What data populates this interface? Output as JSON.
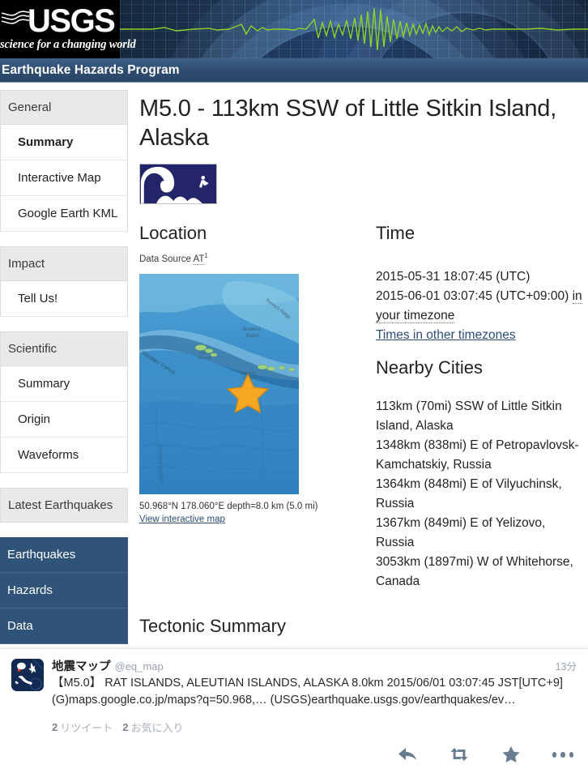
{
  "banner": {
    "logo_word": "USGS",
    "logo_tagline": "science for a changing world",
    "logo_mark_icon": "usgs-wave-mark-icon",
    "seismograph_icon": "seismograph-trace-icon"
  },
  "program_bar": {
    "title": "Earthquake Hazards Program"
  },
  "sidebar": {
    "groups": [
      {
        "header": "General",
        "items": [
          {
            "label": "Summary",
            "active": true
          },
          {
            "label": "Interactive Map",
            "active": false
          },
          {
            "label": "Google Earth KML",
            "active": false
          }
        ]
      },
      {
        "header": "Impact",
        "items": [
          {
            "label": "Tell Us!",
            "active": false
          }
        ]
      },
      {
        "header": "Scientific",
        "items": [
          {
            "label": "Summary",
            "active": false
          },
          {
            "label": "Origin",
            "active": false
          },
          {
            "label": "Waveforms",
            "active": false
          }
        ]
      },
      {
        "header": "Latest Earthquakes",
        "items": []
      }
    ],
    "blue_items": [
      {
        "label": "Earthquakes"
      },
      {
        "label": "Hazards"
      },
      {
        "label": "Data"
      }
    ]
  },
  "main": {
    "title": "M5.0 - 113km SSW of Little Sitkin Island, Alaska",
    "tsunami_icon": "tsunami-wave-icon",
    "location": {
      "heading": "Location",
      "data_source_label": "Data Source",
      "data_source_value": "AT",
      "data_source_footnote": "1",
      "map_icon": "location-map-thumbnail",
      "caption": "50.968°N 178.060°E depth=8.0 km (5.0 mi)",
      "map_link": "View interactive map"
    },
    "time": {
      "heading": "Time",
      "utc": "2015-05-31 18:07:45 (UTC)",
      "local": "2015-06-01 03:07:45 (UTC+09:00)",
      "local_suffix": "in your timezone",
      "other_timezones_link": "Times in other timezones"
    },
    "nearby_cities": {
      "heading": "Nearby Cities",
      "items": [
        "113km (70mi) SSW of Little Sitkin Island, Alaska",
        "1348km (838mi) E of Petropavlovsk-Kamchatskiy, Russia",
        "1364km (848mi) E of Vilyuchinsk, Russia",
        "1367km (849mi) E of Yelizovo, Russia",
        "3053km (1897mi) W of Whitehorse, Canada"
      ]
    },
    "tectonic": {
      "heading": "Tectonic Summary"
    }
  },
  "tweet": {
    "avatar_icon": "japan-map-avatar-icon",
    "name": "地震マップ",
    "handle": "@eq_map",
    "time": "13分",
    "text": "【M5.0】 RAT ISLANDS, ALEUTIAN ISLANDS, ALASKA 8.0km 2015/06/01 03:07:45 JST[UTC+9] (G)maps.google.co.jp/maps?q=50.968,… (USGS)earthquake.usgs.gov/earthquakes/ev…",
    "retweet_count": "2",
    "retweet_label": "リツイート",
    "favorite_count": "2",
    "favorite_label": "お気に入り",
    "actions": [
      {
        "icon": "reply-icon"
      },
      {
        "icon": "retweet-icon"
      },
      {
        "icon": "favorite-star-icon"
      },
      {
        "icon": "more-options-icon"
      }
    ]
  },
  "colors": {
    "program_bar": "#2d4b6d",
    "nav_blue": "#2f5379",
    "link": "#2c4d78",
    "tsunami_navy": "#24246b",
    "star_marker": "#f5a623",
    "seismograph_green": "#8cd22a"
  }
}
